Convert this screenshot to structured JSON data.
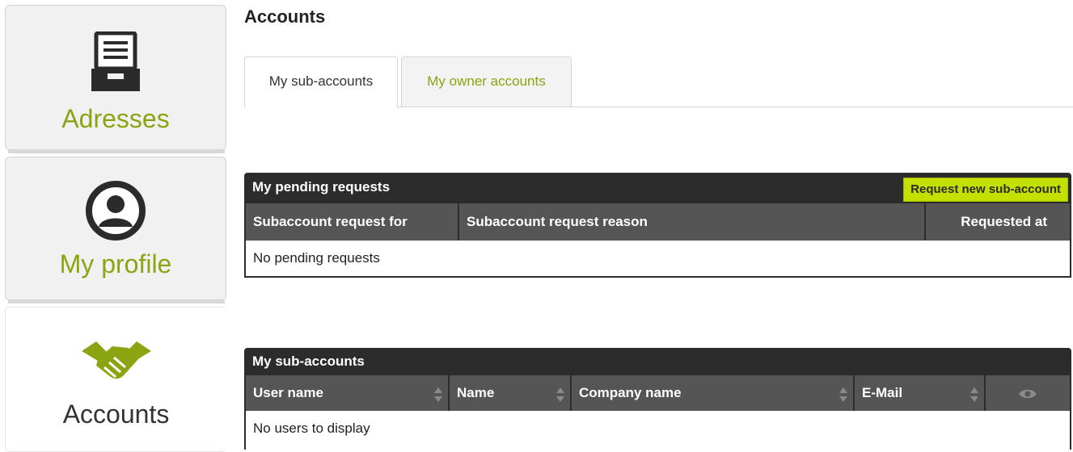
{
  "sidebar": {
    "items": [
      {
        "label": "Adresses",
        "icon": "file-cabinet-icon",
        "active": false
      },
      {
        "label": "My profile",
        "icon": "user-circle-icon",
        "active": false
      },
      {
        "label": "Accounts",
        "icon": "handshake-icon",
        "active": true
      }
    ]
  },
  "page": {
    "title": "Accounts"
  },
  "tabs": [
    {
      "label": "My sub-accounts",
      "active": true
    },
    {
      "label": "My owner accounts",
      "active": false
    }
  ],
  "pending": {
    "title": "My pending requests",
    "request_button": "Request new sub-account",
    "columns": [
      "Subaccount request for",
      "Subaccount request reason",
      "Requested at"
    ],
    "empty_text": "No pending requests"
  },
  "subaccounts": {
    "title": "My sub-accounts",
    "columns": [
      "User name",
      "Name",
      "Company name",
      "E-Mail"
    ],
    "view_icon": "eye-icon",
    "empty_text": "No users to display"
  },
  "colors": {
    "accent_green": "#8aa412",
    "button_lime": "#c4e000",
    "header_dark": "#2c2c2c",
    "header_gray": "#555555"
  }
}
